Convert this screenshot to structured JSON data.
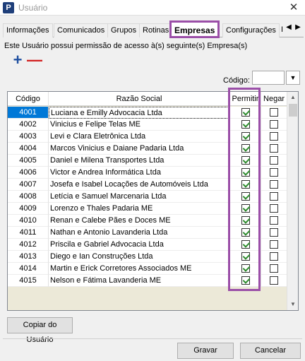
{
  "window": {
    "title": "Usuário",
    "app_icon_letter": "P"
  },
  "tabs": [
    {
      "label": "Informações",
      "active": false
    },
    {
      "label": "Comunicados",
      "active": false
    },
    {
      "label": "Grupos",
      "active": false
    },
    {
      "label": "Rotinas",
      "active": false
    },
    {
      "label": "Empresas",
      "active": true
    },
    {
      "label": "Configurações",
      "active": false
    },
    {
      "label": "I",
      "active": false
    }
  ],
  "description": "Este Usuário possui permissão de acesso à(s) seguinte(s) Empresa(s)",
  "toolbar": {
    "add_icon": "+",
    "remove_icon": "—"
  },
  "filter": {
    "codigo_label": "Código:",
    "codigo_value": ""
  },
  "grid": {
    "columns": [
      "Código",
      "Razão Social",
      "Permitir",
      "Negar"
    ],
    "rows": [
      {
        "codigo": "4001",
        "razao": "Luciana e Emilly Advocacia Ltda",
        "permitir": true,
        "negar": false,
        "selected": true
      },
      {
        "codigo": "4002",
        "razao": "Vinicius e Felipe Telas ME",
        "permitir": true,
        "negar": false
      },
      {
        "codigo": "4003",
        "razao": "Levi e Clara Eletrônica Ltda",
        "permitir": true,
        "negar": false
      },
      {
        "codigo": "4004",
        "razao": "Marcos Vinicius e Daiane Padaria Ltda",
        "permitir": true,
        "negar": false
      },
      {
        "codigo": "4005",
        "razao": "Daniel e Milena Transportes Ltda",
        "permitir": true,
        "negar": false
      },
      {
        "codigo": "4006",
        "razao": "Victor e Andrea Informática Ltda",
        "permitir": true,
        "negar": false
      },
      {
        "codigo": "4007",
        "razao": "Josefa e Isabel Locações de Automóveis Ltda",
        "permitir": true,
        "negar": false
      },
      {
        "codigo": "4008",
        "razao": "Letícia e Samuel Marcenaria Ltda",
        "permitir": true,
        "negar": false
      },
      {
        "codigo": "4009",
        "razao": "Lorenzo e Thales Padaria ME",
        "permitir": true,
        "negar": false
      },
      {
        "codigo": "4010",
        "razao": "Renan e Calebe Pães e Doces ME",
        "permitir": true,
        "negar": false
      },
      {
        "codigo": "4011",
        "razao": "Nathan e Antonio Lavanderia Ltda",
        "permitir": true,
        "negar": false
      },
      {
        "codigo": "4012",
        "razao": "Priscila e Gabriel Advocacia Ltda",
        "permitir": true,
        "negar": false
      },
      {
        "codigo": "4013",
        "razao": "Diego e Ian Construções Ltda",
        "permitir": true,
        "negar": false
      },
      {
        "codigo": "4014",
        "razao": "Martin e Erick Corretores Associados ME",
        "permitir": true,
        "negar": false
      },
      {
        "codigo": "4015",
        "razao": "Nelson e Fátima Lavanderia ME",
        "permitir": true,
        "negar": false
      }
    ]
  },
  "buttons": {
    "copy": "Copiar do Usuário",
    "save": "Gravar",
    "cancel": "Cancelar"
  },
  "colors": {
    "highlight": "#9b4fa8",
    "selection": "#0078d7",
    "add": "#1f4fa0",
    "remove": "#d21f1f"
  }
}
